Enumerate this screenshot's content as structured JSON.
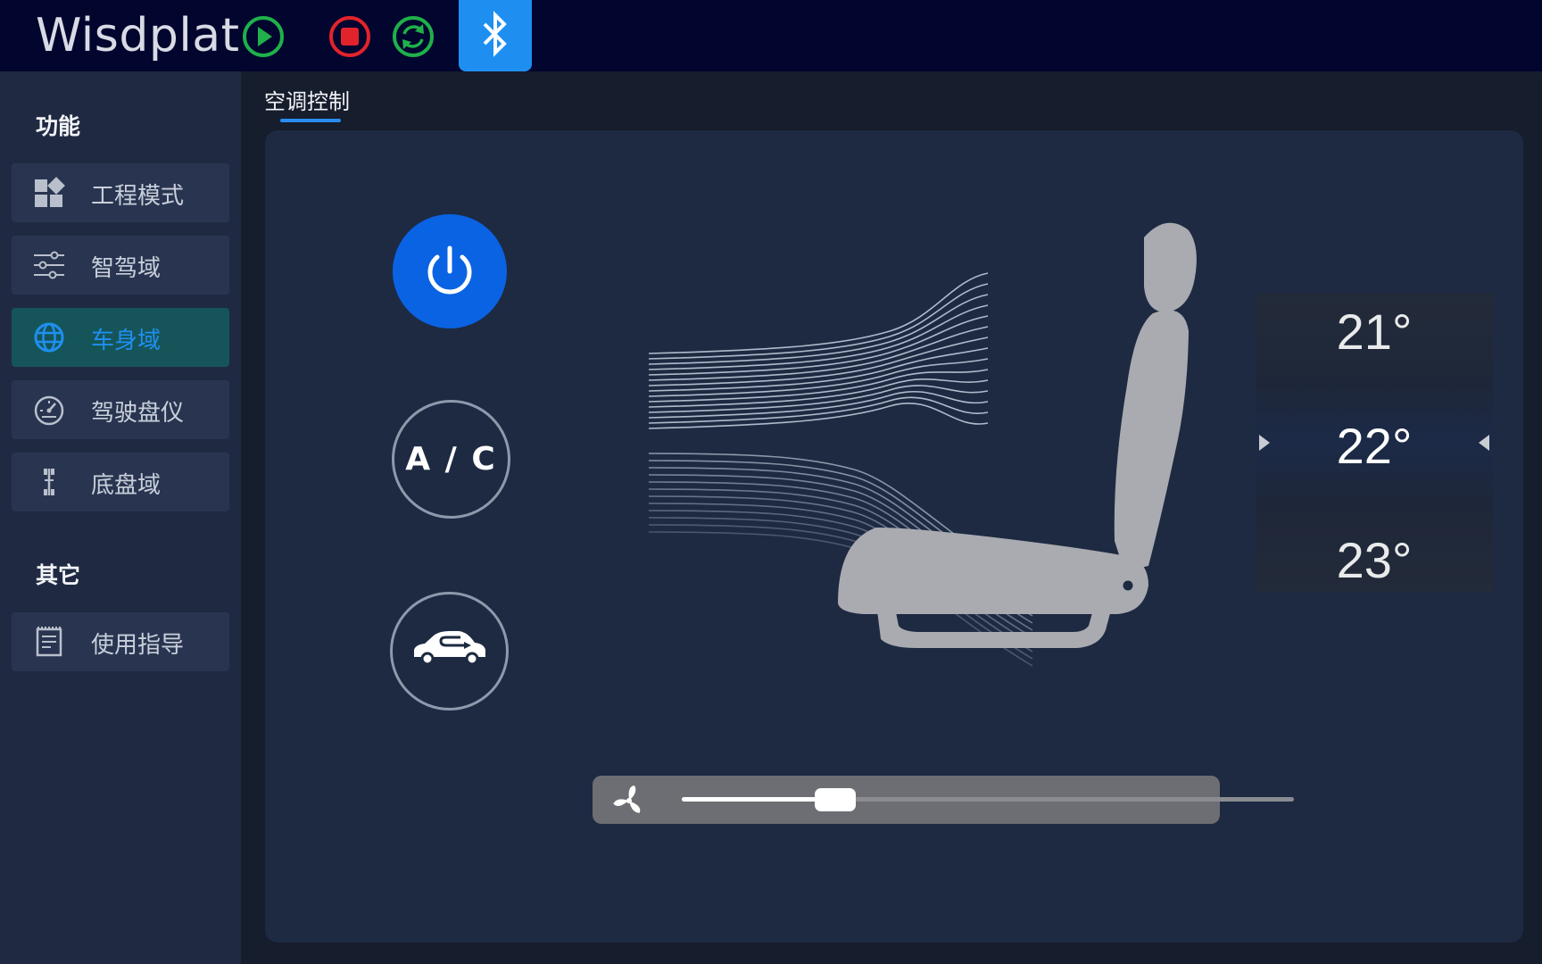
{
  "app": {
    "title": "Wisdplat"
  },
  "toolbar": {
    "buttons": [
      {
        "name": "play",
        "icon": "play-icon",
        "color": "#1fb04a"
      },
      {
        "name": "stop",
        "icon": "stop-icon",
        "color": "#e3232b"
      },
      {
        "name": "refresh",
        "icon": "refresh-icon",
        "color": "#1fb04a"
      },
      {
        "name": "bluetooth",
        "icon": "bluetooth-icon",
        "color": "#1e8ff0"
      }
    ]
  },
  "sidebar": {
    "sections": [
      {
        "title": "功能",
        "items": [
          {
            "label": "工程模式",
            "icon": "grid-apps-icon",
            "active": false
          },
          {
            "label": "智驾域",
            "icon": "sliders-icon",
            "active": false
          },
          {
            "label": "车身域",
            "icon": "globe-icon",
            "active": true
          },
          {
            "label": "驾驶盘仪",
            "icon": "speedometer-icon",
            "active": false
          },
          {
            "label": "底盘域",
            "icon": "chassis-icon",
            "active": false
          }
        ]
      },
      {
        "title": "其它",
        "items": [
          {
            "label": "使用指导",
            "icon": "document-icon",
            "active": false
          }
        ]
      }
    ]
  },
  "tabs": [
    {
      "label": "空调控制",
      "active": true
    }
  ],
  "climate": {
    "power_button": {
      "icon": "power-icon",
      "on": true
    },
    "ac_button": {
      "label": "A / C"
    },
    "recirculation_button": {
      "icon": "car-recirculation-icon"
    },
    "temperature_options": [
      "21°",
      "22°",
      "23°"
    ],
    "selected_temperature": "22°",
    "fan": {
      "icon": "fan-icon",
      "level_fraction": 0.25
    }
  },
  "colors": {
    "accent": "#1e8ff0",
    "active_nav_bg": "#155559",
    "power_on": "#0a63e3"
  }
}
